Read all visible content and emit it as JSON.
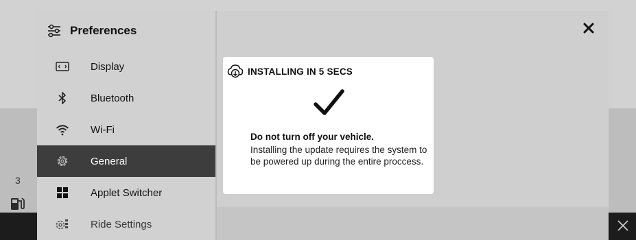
{
  "preferences": {
    "title": "Preferences",
    "icon": "sliders-icon",
    "items": [
      {
        "label": "Display",
        "icon": "display-icon",
        "active": false
      },
      {
        "label": "Bluetooth",
        "icon": "bluetooth-icon",
        "active": false
      },
      {
        "label": "Wi-Fi",
        "icon": "wifi-icon",
        "active": false
      },
      {
        "label": "General",
        "icon": "gear-icon",
        "active": true
      },
      {
        "label": "Applet Switcher",
        "icon": "grid-icon",
        "active": false
      },
      {
        "label": "Ride Settings",
        "icon": "ride-settings-icon",
        "active": false
      }
    ]
  },
  "dialog": {
    "title": "INSTALLING IN 5 SECS",
    "icon": "cloud-download-icon",
    "status_icon": "checkmark-icon",
    "warning": "Do not turn off your vehicle.",
    "message": "Installing the update requires the system to be powered up during the entire proccess."
  },
  "background": {
    "number": "3",
    "fuel_icon": "fuel-pump-icon",
    "close_icon": "close-icon"
  },
  "colors": {
    "active_item_bg": "#3d3d3d",
    "active_item_text": "#ffffff",
    "panel_bg": "#c9c9c9",
    "dialog_bg": "#ffffff"
  }
}
